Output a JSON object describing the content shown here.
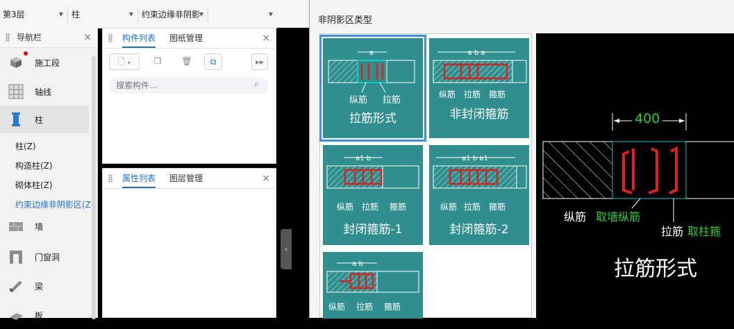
{
  "topbar": {
    "floor": "第3层",
    "category": "柱",
    "subtype": "约束边缘非阴影"
  },
  "nav": {
    "title": "导航栏",
    "items": [
      {
        "label": "施工段",
        "icon": "cube-icon"
      },
      {
        "label": "轴线",
        "icon": "grid-icon"
      },
      {
        "label": "柱",
        "icon": "column-icon"
      }
    ],
    "subitems": [
      "柱(Z)",
      "构造柱(Z)",
      "砌体柱(Z)",
      "约束边缘非阴影区(Z"
    ],
    "items2": [
      {
        "label": "墙",
        "icon": "wall-icon"
      },
      {
        "label": "门窗洞",
        "icon": "door-icon"
      },
      {
        "label": "梁",
        "icon": "beam-icon"
      },
      {
        "label": "板",
        "icon": "slab-icon"
      }
    ]
  },
  "components_panel": {
    "tab_active": "构件列表",
    "tab_other": "图纸管理",
    "search_placeholder": "搜索构件..."
  },
  "properties_panel": {
    "tab_active": "属性列表",
    "tab_other": "图层管理"
  },
  "dialog": {
    "title": "非阴影区类型",
    "cards": [
      {
        "caption": "拉筋形式",
        "labels": [
          "纵筋",
          "拉筋"
        ],
        "dim": "a"
      },
      {
        "caption": "非封闭箍筋",
        "labels": [
          "纵筋",
          "拉筋",
          "箍筋"
        ],
        "dim": "a b a"
      },
      {
        "caption": "封闭箍筋-1",
        "labels": [
          "纵筋",
          "拉筋",
          "箍筋"
        ],
        "dim": "a1 b"
      },
      {
        "caption": "封闭箍筋-2",
        "labels": [
          "纵筋",
          "拉筋",
          "箍筋"
        ],
        "dim": "a1 b a1"
      },
      {
        "caption": "",
        "labels": [
          "纵筋",
          "拉筋",
          "箍筋"
        ],
        "dim": "a b"
      }
    ],
    "preview": {
      "dimension": "400",
      "label_long": "纵筋",
      "label_long_value": "取墙纵筋",
      "label_tie": "拉筋",
      "label_tie_value": "取柱箍",
      "caption": "拉筋形式",
      "colors": {
        "accent_green": "#2ecc2e",
        "rebar_red": "#e02020",
        "outline_cyan": "#00c8c8"
      }
    }
  }
}
